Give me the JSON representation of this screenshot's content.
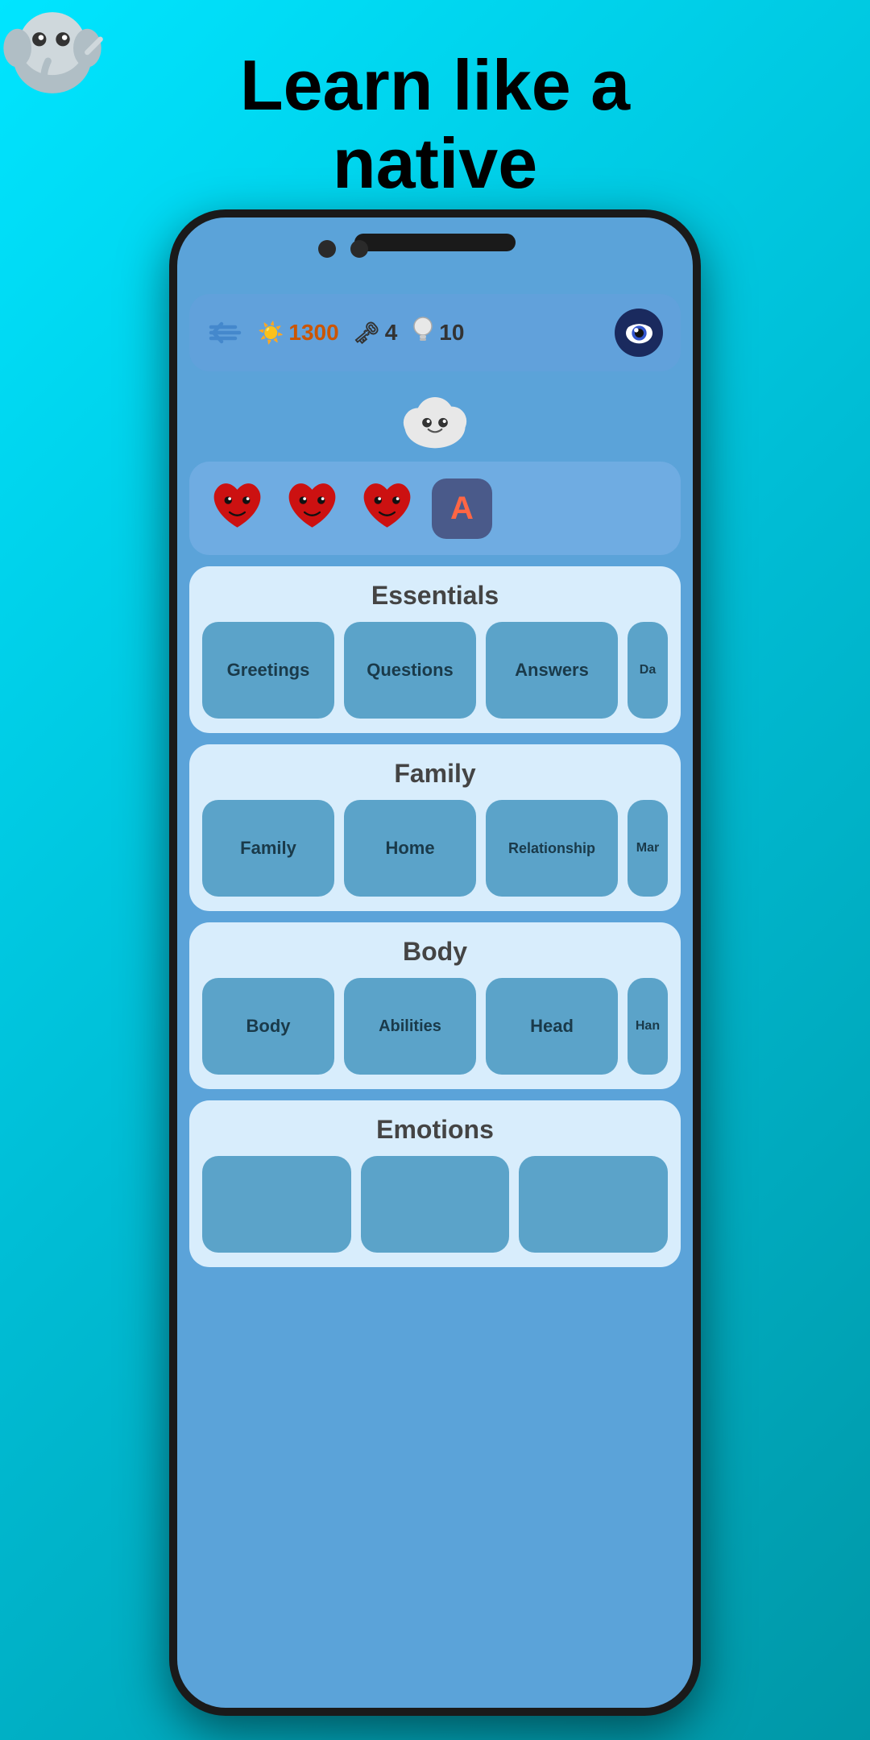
{
  "app": {
    "title_line1": "Learn like a",
    "title_line2": "native"
  },
  "stats": {
    "coins": "1300",
    "keys": "4",
    "bulbs": "10",
    "coin_icon": "☀",
    "key_icon": "🗝",
    "bulb_icon": "💡"
  },
  "hearts": {
    "heart1": "❤",
    "heart2": "❤",
    "heart3": "❤",
    "letter": "A"
  },
  "sections": [
    {
      "id": "essentials",
      "title": "Essentials",
      "items": [
        "Greetings",
        "Questions",
        "Answers",
        "Da..."
      ]
    },
    {
      "id": "family",
      "title": "Family",
      "items": [
        "Family",
        "Home",
        "Relationship",
        "Marri..."
      ]
    },
    {
      "id": "body",
      "title": "Body",
      "items": [
        "Body",
        "Abilities",
        "Head",
        "Han..."
      ]
    },
    {
      "id": "emotions",
      "title": "Emotions",
      "items": [
        "",
        "",
        ""
      ]
    }
  ],
  "back_arrow": "⟹"
}
